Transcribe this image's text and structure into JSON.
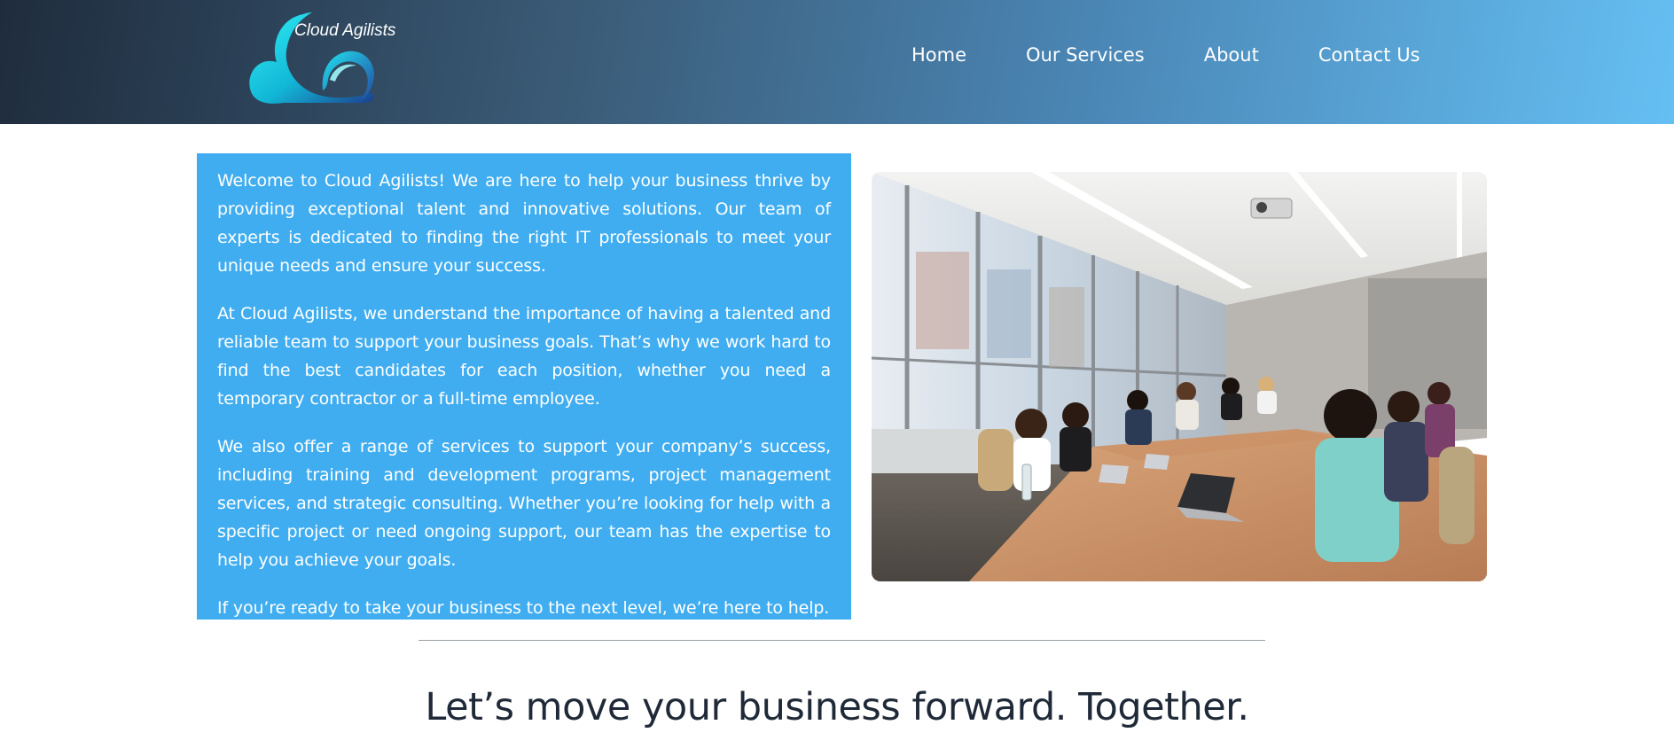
{
  "brand": {
    "name": "Cloud Agilists",
    "icon": "cloud-logo-icon",
    "colors": {
      "cyan": "#19d3e6",
      "navy": "#1f3f8a"
    }
  },
  "header": {
    "gradient_start": "#1f2c3d",
    "gradient_end": "#65bff3"
  },
  "nav": {
    "home": "Home",
    "services": "Our Services",
    "about": "About",
    "contact": "Contact Us"
  },
  "intro": {
    "background": "#40adf0",
    "paragraphs": [
      "Welcome to Cloud Agilists! We are here to help your business thrive by providing exceptional talent and innovative solutions. Our team of experts is dedicated to finding the right IT professionals to meet your unique needs and ensure your success.",
      "At Cloud Agilists, we understand the importance of having a talented and reliable team to support your business goals. That’s why we work hard to find the best candidates for each position, whether you need a temporary contractor or a full-time employee.",
      "We also offer a range of services to support your company’s success, including training and development programs, project management services, and strategic consulting. Whether you’re looking for help with a specific project or need ongoing support, our team has the expertise to help you achieve your goals.",
      "If you’re ready to take your business to the next level, we’re here to help."
    ]
  },
  "photo": {
    "subject": "team-meeting-conference-room-photo"
  },
  "tagline": "Let’s move your business forward. Together."
}
